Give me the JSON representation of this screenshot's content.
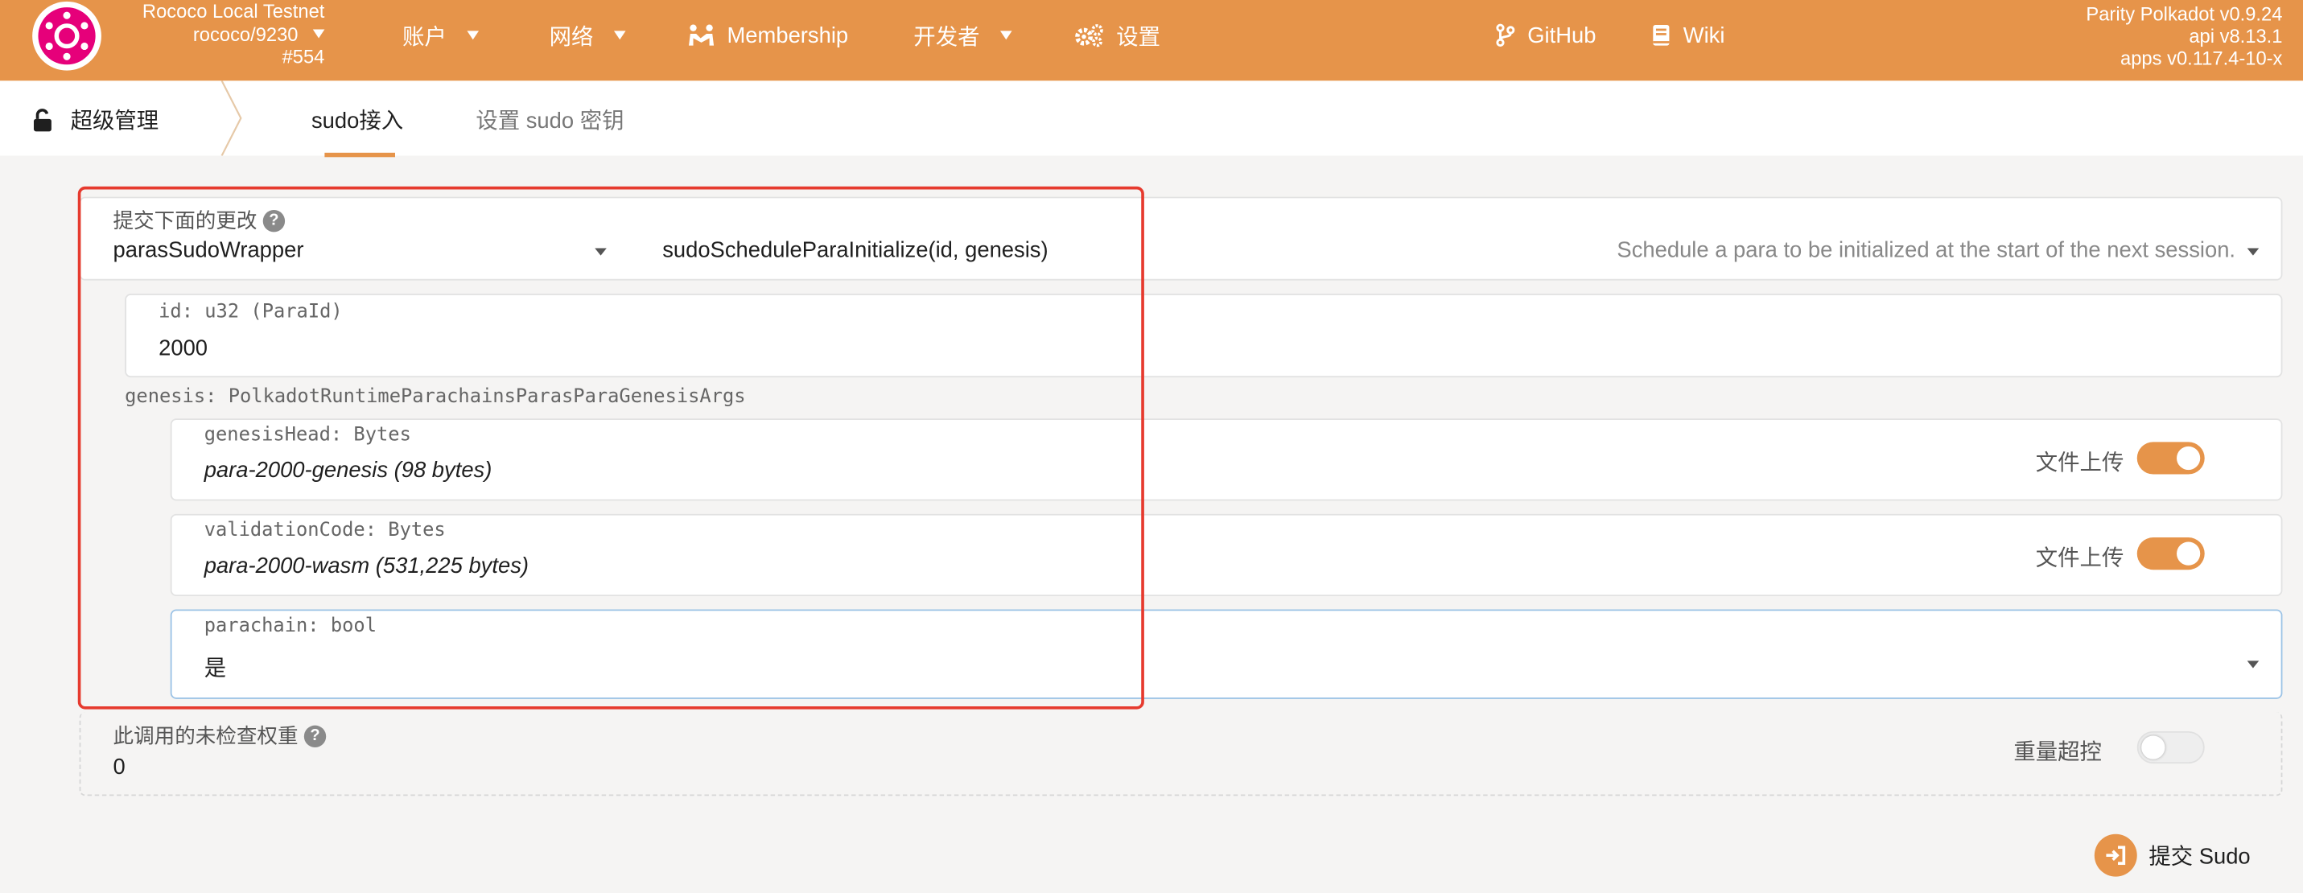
{
  "header": {
    "chain_name": "Rococo Local Testnet",
    "chain_id": "rococo/9230",
    "block": "#554",
    "nav": [
      {
        "label": "账户",
        "icon": "chevron-down-icon"
      },
      {
        "label": "网络",
        "icon": "chevron-down-icon"
      },
      {
        "label": "Membership",
        "icon": "people-icon"
      },
      {
        "label": "开发者",
        "icon": "chevron-down-icon"
      },
      {
        "label": "设置",
        "icon": "gears-icon"
      },
      {
        "label": "GitHub",
        "icon": "code-branch-icon"
      },
      {
        "label": "Wiki",
        "icon": "book-icon"
      }
    ],
    "version_node": "Parity Polkadot v0.9.24",
    "version_api": "api v8.13.1",
    "version_apps": "apps v0.117.4-10-x",
    "colors": {
      "bar": "#e6944a",
      "text": "#ffffff"
    }
  },
  "subnav": {
    "section": "超级管理",
    "tabs": [
      {
        "label": "sudo接入",
        "active": true
      },
      {
        "label": "设置 sudo 密钥",
        "active": false
      }
    ]
  },
  "extrinsic": {
    "submit_label": "提交下面的更改",
    "module": "parasSudoWrapper",
    "method": "sudoScheduleParaInitialize(id, genesis)",
    "method_doc": "Schedule a para to be initialized at the start of the next session.",
    "params": {
      "id_label": "id: u32 (ParaId)",
      "id_value": "2000",
      "genesis_label": "genesis: PolkadotRuntimeParachainsParasParaGenesisArgs",
      "genesis_head_label": "genesisHead: Bytes",
      "genesis_head_value": "para-2000-genesis (98 bytes)",
      "validation_code_label": "validationCode: Bytes",
      "validation_code_value": "para-2000-wasm (531,225 bytes)",
      "parachain_label": "parachain: bool",
      "parachain_value": "是",
      "file_upload_label": "文件上传",
      "genesis_head_upload_on": true,
      "validation_code_upload_on": true
    }
  },
  "weight": {
    "label": "此调用的未检查权重",
    "value": "0",
    "override_label": "重量超控",
    "override_on": false
  },
  "submit_button": {
    "label": "提交 Sudo",
    "icon": "sign-in-icon"
  },
  "accent_color": "#e6944a",
  "highlight_color": "#e63a2e"
}
